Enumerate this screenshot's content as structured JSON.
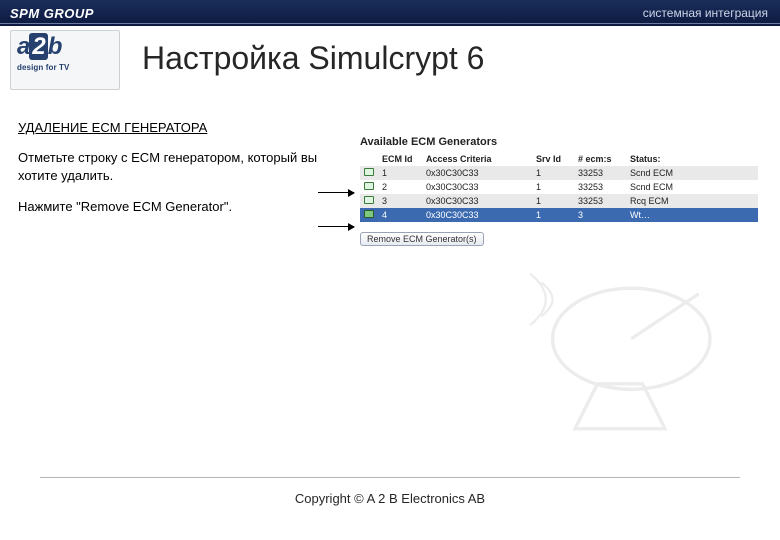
{
  "header": {
    "brand": "SPM GROUP",
    "tagline": "системная интеграция"
  },
  "logo": {
    "text_a": "a",
    "text_2": "2",
    "text_b": "b",
    "subtitle": "design for TV"
  },
  "title": "Настройка Simulcrypt 6",
  "section": {
    "heading": "УДАЛЕНИЕ  ECM ГЕНЕРАТОРА",
    "step1": "Отметьте строку с ECM генератором, который вы хотите удалить.",
    "step2": "Нажмите \"Remove ECM Generator\"."
  },
  "screenshot": {
    "title": "Available ECM Generators",
    "columns": [
      "",
      "ECM Id",
      "Access Criteria",
      "Srv Id",
      "# ecm:s",
      "Status:"
    ],
    "rows": [
      {
        "ecm_id": "1",
        "access": "0x30C30C33",
        "srv": "1",
        "ecms": "33253",
        "status": "Scnd ECM",
        "selected": false,
        "alt": true
      },
      {
        "ecm_id": "2",
        "access": "0x30C30C33",
        "srv": "1",
        "ecms": "33253",
        "status": "Scnd ECM",
        "selected": false,
        "alt": false
      },
      {
        "ecm_id": "3",
        "access": "0x30C30C33",
        "srv": "1",
        "ecms": "33253",
        "status": "Rcq ECM",
        "selected": false,
        "alt": true
      },
      {
        "ecm_id": "4",
        "access": "0x30C30C33",
        "srv": "1",
        "ecms": "3",
        "status": "Wt…",
        "selected": true,
        "alt": false
      }
    ],
    "remove_button": "Remove ECM Generator(s)"
  },
  "footer": {
    "copyright": "Copyright © A 2 B Electronics AB"
  }
}
